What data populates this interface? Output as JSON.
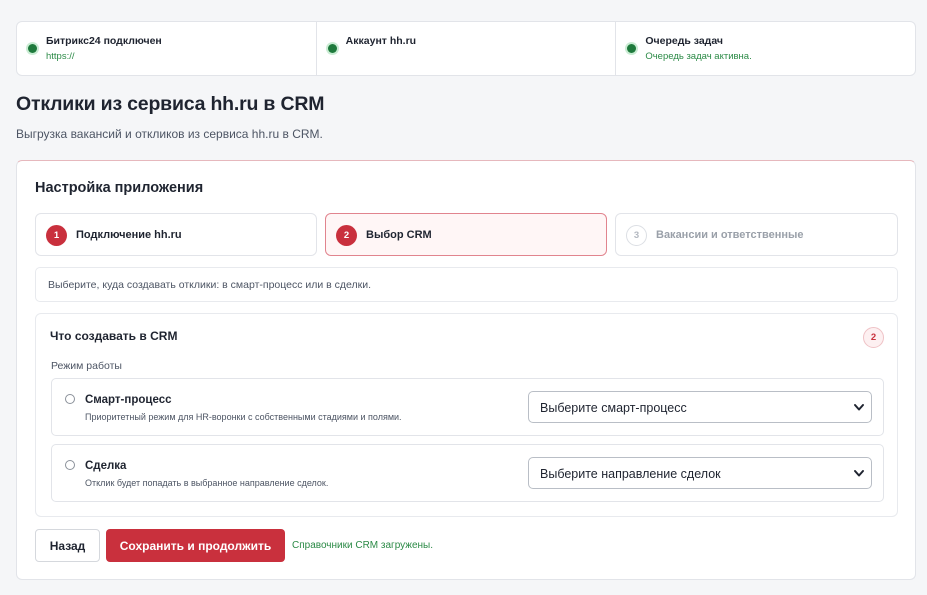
{
  "status": [
    {
      "title": "Битрикс24 подключен",
      "subtitle": "https://"
    },
    {
      "title": "Аккаунт hh.ru",
      "subtitle": ""
    },
    {
      "title": "Очередь задач",
      "subtitle": "Очередь задач активна."
    }
  ],
  "colors": {
    "accent": "#c9303d",
    "success": "#1e7a3c",
    "success_text": "#2b8a46"
  },
  "page": {
    "title": "Отклики из сервиса hh.ru в CRM",
    "subtitle": "Выгрузка вакансий и откликов из сервиса hh.ru в CRM."
  },
  "setup": {
    "title": "Настройка приложения",
    "steps": [
      {
        "num": "1",
        "label": "Подключение hh.ru",
        "state": "done"
      },
      {
        "num": "2",
        "label": "Выбор CRM",
        "state": "active"
      },
      {
        "num": "3",
        "label": "Вакансии и ответственные",
        "state": "pending"
      }
    ],
    "hint": "Выберите, куда создавать отклики: в смарт-процесс или в сделки."
  },
  "crm": {
    "title": "Что создавать в CRM",
    "badge": "2",
    "mode_label": "Режим работы",
    "options": [
      {
        "name": "Смарт-процесс",
        "description": "Приоритетный режим для HR-воронки с собственными стадиями и полями.",
        "select_value": "Выберите смарт-процесс"
      },
      {
        "name": "Сделка",
        "description": "Отклик будет попадать в выбранное направление сделок.",
        "select_value": "Выберите направление сделок"
      }
    ]
  },
  "actions": {
    "back_label": "Назад",
    "save_label": "Сохранить и продолжить",
    "status_text": "Справочники CRM загружены."
  }
}
